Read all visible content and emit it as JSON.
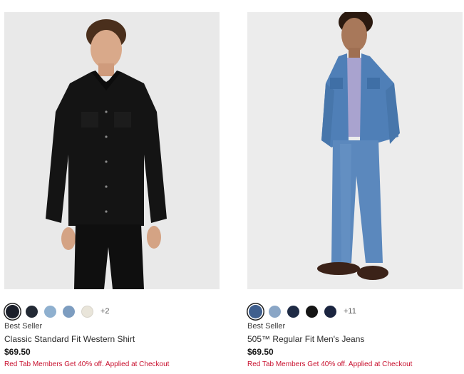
{
  "products": [
    {
      "image_alt": "Classic Standard Fit Western Shirt",
      "swatches": [
        "#1b1f2a",
        "#232a35",
        "#8fb0cf",
        "#7d9dc0",
        "#e9e5da"
      ],
      "more_colors": "+2",
      "badge": "Best Seller",
      "name": "Classic Standard Fit Western Shirt",
      "price": "$69.50",
      "promo": "Red Tab Members Get 40% off. Applied at Checkout"
    },
    {
      "image_alt": "505™ Regular Fit Men's Jeans",
      "swatches": [
        "#3f5f8e",
        "#8aa6c6",
        "#1f2b45",
        "#151515",
        "#1b2540"
      ],
      "more_colors": "+11",
      "badge": "Best Seller",
      "name": "505™ Regular Fit Men's Jeans",
      "price": "$69.50",
      "promo": "Red Tab Members Get 40% off. Applied at Checkout"
    }
  ]
}
